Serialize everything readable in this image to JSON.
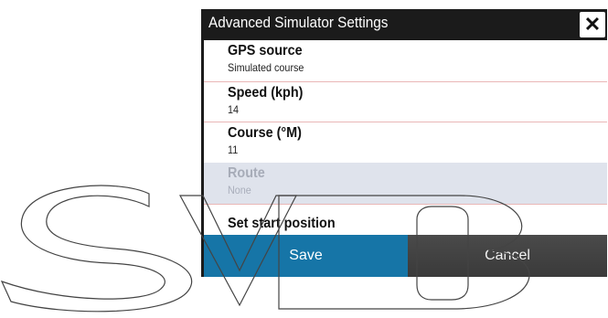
{
  "dialog": {
    "title": "Advanced Simulator Settings",
    "close_icon": "close-icon",
    "close_glyph": "✕"
  },
  "settings": [
    {
      "label": "GPS source",
      "value": "Simulated course",
      "enabled": true
    },
    {
      "label": "Speed (kph)",
      "value": "14",
      "enabled": true
    },
    {
      "label": "Course (°M)",
      "value": "11",
      "enabled": true
    },
    {
      "label": "Route",
      "value": "None",
      "enabled": false
    },
    {
      "label": "Set start position",
      "value": "",
      "enabled": true
    }
  ],
  "buttons": {
    "save": "Save",
    "cancel": "Cancel"
  },
  "colors": {
    "title_bar": "#1b1b1b",
    "save_button": "#1675a7",
    "cancel_button": "#404040",
    "disabled_row": "#dfe3ec"
  }
}
